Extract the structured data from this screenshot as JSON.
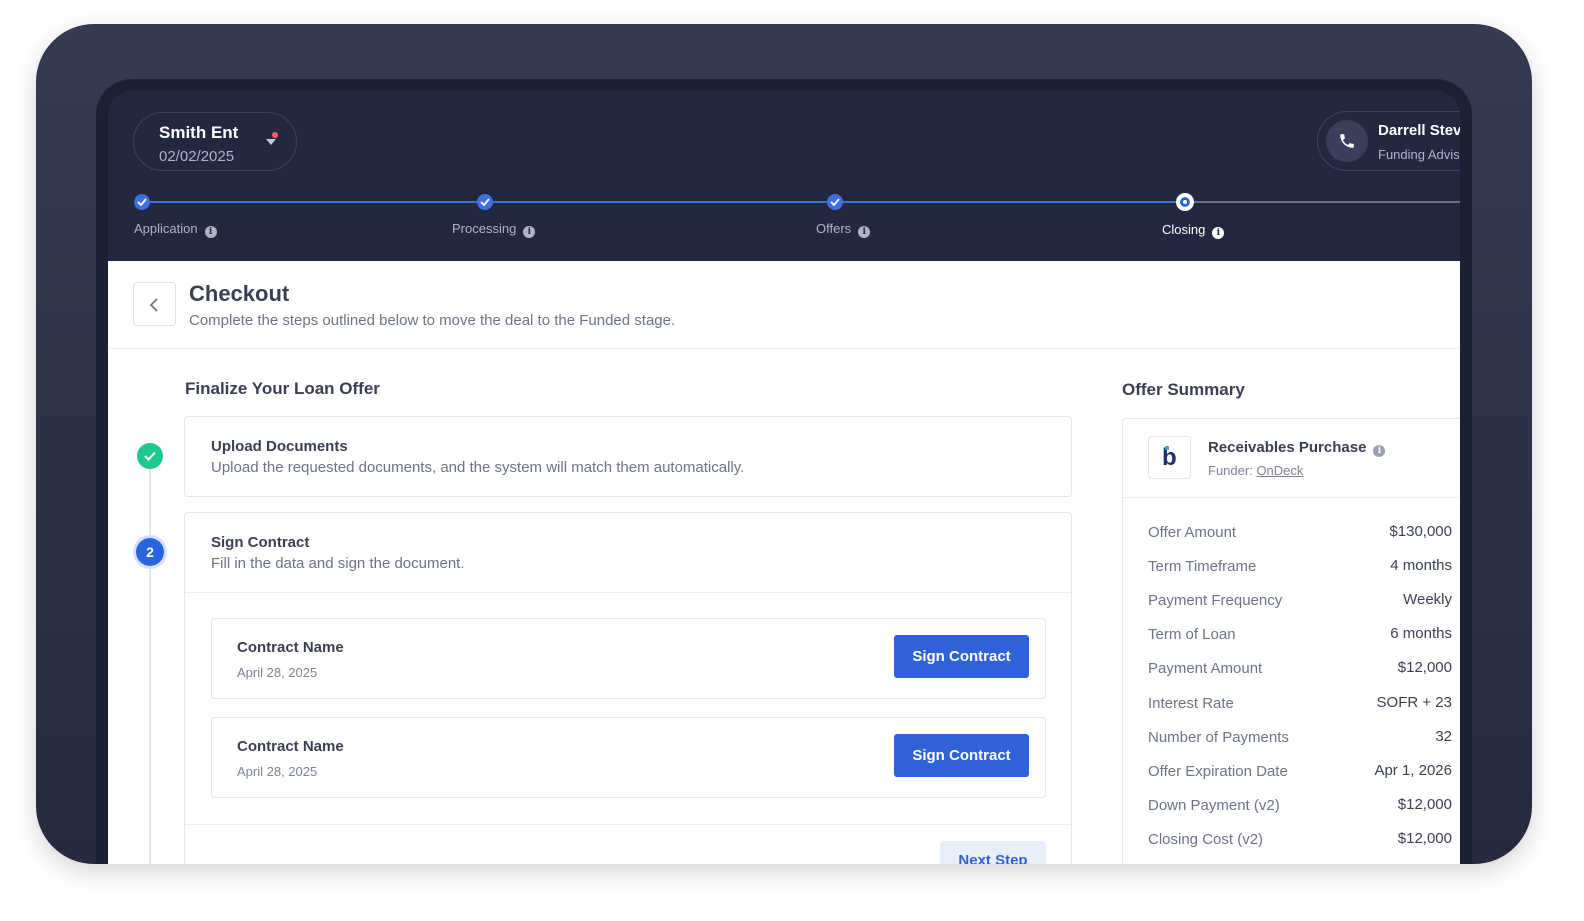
{
  "deal": {
    "name": "Smith Ent",
    "date": "02/02/2025"
  },
  "advisor": {
    "name": "Darrell Stev",
    "role": "Funding Advis"
  },
  "stages": [
    {
      "label": "Application",
      "status": "complete"
    },
    {
      "label": "Processing",
      "status": "complete"
    },
    {
      "label": "Offers",
      "status": "complete"
    },
    {
      "label": "Closing",
      "status": "current"
    }
  ],
  "page": {
    "title": "Checkout",
    "subtitle": "Complete the steps outlined below to move the deal to the Funded stage."
  },
  "finalize": {
    "title": "Finalize Your Loan Offer",
    "steps": [
      {
        "badge": "",
        "title": "Upload Documents",
        "description": "Upload the requested documents, and the system will match them automatically."
      },
      {
        "badge": "2",
        "title": "Sign Contract",
        "description": "Fill in the data and sign the document."
      }
    ],
    "contracts": [
      {
        "name": "Contract Name",
        "date": "April 28, 2025",
        "button": "Sign Contract"
      },
      {
        "name": "Contract Name",
        "date": "April 28, 2025",
        "button": "Sign Contract"
      }
    ],
    "next_button": "Next Step"
  },
  "summary": {
    "title": "Offer Summary",
    "product": "Receivables Purchase",
    "funder_prefix": "Funder:",
    "funder": "OnDeck",
    "logo_letter": "b",
    "rows": [
      {
        "label": "Offer Amount",
        "value": "$130,000"
      },
      {
        "label": "Term Timeframe",
        "value": "4 months"
      },
      {
        "label": "Payment Frequency",
        "value": "Weekly"
      },
      {
        "label": "Term of Loan",
        "value": "6 months"
      },
      {
        "label": "Payment Amount",
        "value": "$12,000"
      },
      {
        "label": "Interest Rate",
        "value": "SOFR + 23"
      },
      {
        "label": "Number of Payments",
        "value": "32"
      },
      {
        "label": "Offer Expiration Date",
        "value": "Apr 1, 2026"
      },
      {
        "label": "Down Payment (v2)",
        "value": "$12,000"
      },
      {
        "label": "Closing Cost (v2)",
        "value": "$12,000"
      }
    ]
  },
  "colors": {
    "accent": "#2f62d8",
    "success": "#1fc98e",
    "header_bg": "#232841",
    "notification": "#ff5a6a"
  },
  "icons": [
    "chevron-down-icon",
    "phone-icon",
    "check-icon",
    "info-icon",
    "chevron-left-icon"
  ]
}
